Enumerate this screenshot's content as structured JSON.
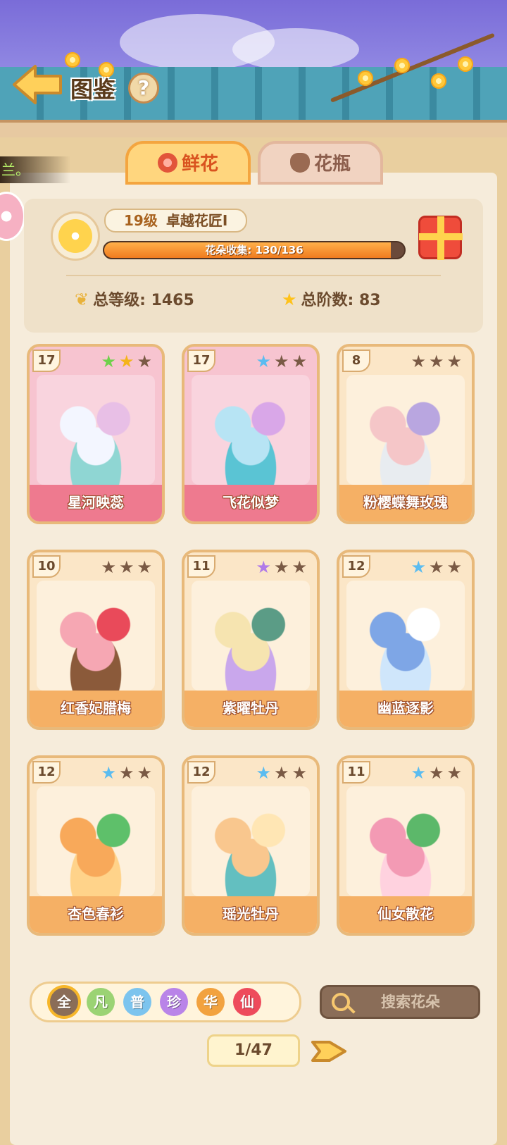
{
  "header": {
    "title": "图鉴",
    "help_label": "?",
    "ticker_text": "兰。"
  },
  "tabs": [
    {
      "label": "鲜花",
      "active": true,
      "icon": "rose-icon"
    },
    {
      "label": "花瓶",
      "active": false,
      "icon": "vase-icon"
    }
  ],
  "summary": {
    "level": "19级",
    "title": "卓越花匠I",
    "collection_label": "花朵收集: 130/136",
    "collected": 130,
    "total": 136,
    "total_level": "总等级: 1465",
    "total_stars": "总阶数: 83"
  },
  "cards": [
    {
      "level": "17",
      "name": "星河映蕊",
      "stars": [
        "#6fd14b",
        "#f4b41a",
        "#7a5a45"
      ],
      "theme": "pink",
      "art_colors": [
        "#f3f6ff",
        "#8fd6d3",
        "#e8bfe6"
      ]
    },
    {
      "level": "17",
      "name": "飞花似梦",
      "stars": [
        "#5bbcf0",
        "#7a5a45",
        "#7a5a45"
      ],
      "theme": "pink",
      "art_colors": [
        "#b7e4f4",
        "#5ac4d4",
        "#d9a7e8"
      ]
    },
    {
      "level": "8",
      "name": "粉樱蝶舞玫瑰",
      "stars": [
        "#7a5a45",
        "#7a5a45",
        "#7a5a45"
      ],
      "theme": "cream",
      "art_colors": [
        "#f5c6c8",
        "#e8ecf0",
        "#b9a6e0"
      ]
    },
    {
      "level": "10",
      "name": "红香妃腊梅",
      "stars": [
        "#7a5a45",
        "#7a5a45",
        "#7a5a45"
      ],
      "theme": "cream",
      "art_colors": [
        "#f6a7b3",
        "#8b5a3a",
        "#e94a5a"
      ]
    },
    {
      "level": "11",
      "name": "紫曜牡丹",
      "stars": [
        "#b07ae8",
        "#7a5a45",
        "#7a5a45"
      ],
      "theme": "cream",
      "art_colors": [
        "#f6e4b0",
        "#c9a7ec",
        "#5b9c86"
      ]
    },
    {
      "level": "12",
      "name": "幽蓝逐影",
      "stars": [
        "#5bbcf0",
        "#7a5a45",
        "#7a5a45"
      ],
      "theme": "cream",
      "art_colors": [
        "#7ea6e6",
        "#cfe6fb",
        "#ffffff"
      ]
    },
    {
      "level": "12",
      "name": "杏色春衫",
      "stars": [
        "#5bbcf0",
        "#7a5a45",
        "#7a5a45"
      ],
      "theme": "cream",
      "art_colors": [
        "#f8a95a",
        "#ffd38a",
        "#5ec06a"
      ]
    },
    {
      "level": "12",
      "name": "瑶光牡丹",
      "stars": [
        "#5bbcf0",
        "#7a5a45",
        "#7a5a45"
      ],
      "theme": "cream",
      "art_colors": [
        "#f9c78e",
        "#63bfc0",
        "#ffe6b4"
      ]
    },
    {
      "level": "11",
      "name": "仙女散花",
      "stars": [
        "#5bbcf0",
        "#7a5a45",
        "#7a5a45"
      ],
      "theme": "cream",
      "art_colors": [
        "#f39ab4",
        "#ffd2df",
        "#5cb86a"
      ]
    }
  ],
  "filters": [
    {
      "label": "全",
      "color": "#8a6d58",
      "selected": true
    },
    {
      "label": "凡",
      "color": "#9bd374",
      "selected": false
    },
    {
      "label": "普",
      "color": "#7cc4ee",
      "selected": false
    },
    {
      "label": "珍",
      "color": "#b984e8",
      "selected": false
    },
    {
      "label": "华",
      "color": "#f2a23f",
      "selected": false
    },
    {
      "label": "仙",
      "color": "#ee4b5c",
      "selected": false
    }
  ],
  "search": {
    "placeholder": "搜索花朵"
  },
  "pager": {
    "label": "1/47"
  }
}
